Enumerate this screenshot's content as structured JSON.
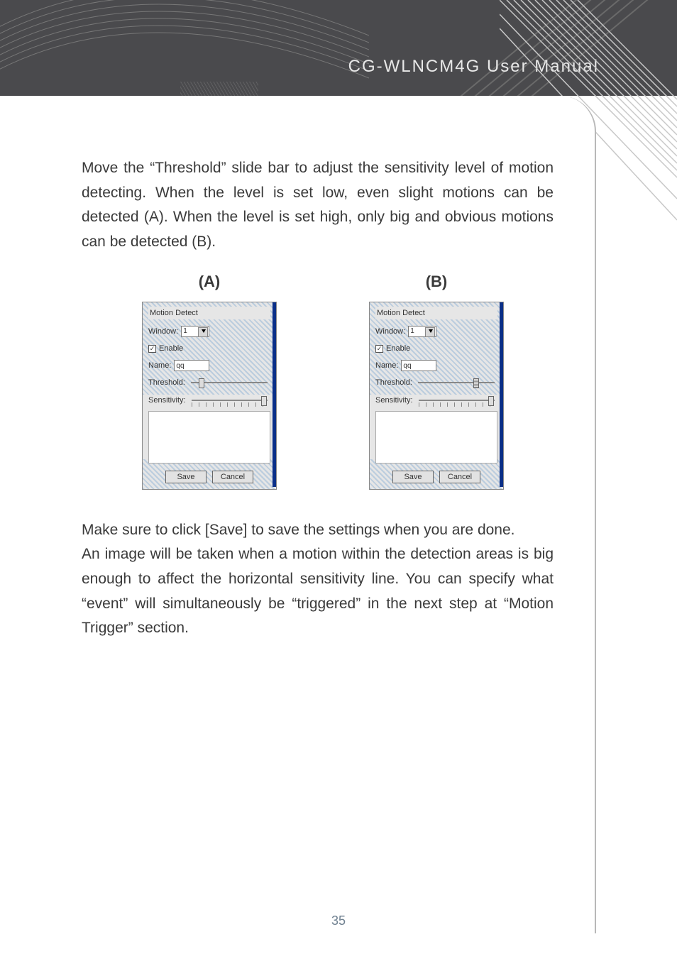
{
  "header": {
    "title": "CG-WLNCM4G User Manual"
  },
  "para1": "Move the “Threshold” slide bar to adjust the sensitivity level of motion detecting. When the level is set low, even slight motions can be detected (A). When the level is set high, only big and obvious motions can be detected (B).",
  "labels": {
    "a": "(A)",
    "b": "(B)"
  },
  "panelA": {
    "group": "Motion Detect",
    "window_label": "Window:",
    "window_value": "1",
    "enable_label": "Enable",
    "enable_checked": "✓",
    "name_label": "Name:",
    "name_value": "qq",
    "threshold_label": "Threshold:",
    "threshold_pos": "10%",
    "sensitivity_label": "Sensitivity:",
    "sensitivity_pos": "92%",
    "save": "Save",
    "cancel": "Cancel"
  },
  "panelB": {
    "group": "Motion Detect",
    "window_label": "Window:",
    "window_value": "1",
    "enable_label": "Enable",
    "enable_checked": "✓",
    "name_label": "Name:",
    "name_value": "qq",
    "threshold_label": "Threshold:",
    "threshold_pos": "72%",
    "sensitivity_label": "Sensitivity:",
    "sensitivity_pos": "92%",
    "save": "Save",
    "cancel": "Cancel"
  },
  "para2": "Make sure to click [Save] to save the settings when you are done.",
  "para3": "An image will be taken when a motion within the detection areas is big enough to affect the horizontal sensitivity line. You can specify what “event” will simultaneously be “triggered” in the next step at “Motion Trigger” section.",
  "page_number": "35"
}
